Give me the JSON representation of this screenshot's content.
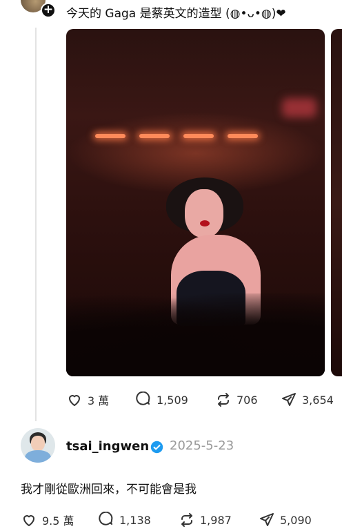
{
  "post1": {
    "text": "今天的 Gaga 是蔡英文的造型 (◍•ᴗ•◍)❤",
    "actions": {
      "likes": "3 萬",
      "comments": "1,509",
      "reposts": "706",
      "shares": "3,654"
    }
  },
  "post2": {
    "username": "tsai_ingwen",
    "date": "2025-5-23",
    "text": "我才剛從歐洲回來，不可能會是我",
    "actions": {
      "likes": "9.5 萬",
      "comments": "1,138",
      "reposts": "1,987",
      "shares": "5,090"
    }
  },
  "colors": {
    "verified": "#1d9bf0",
    "muted_text": "#999999",
    "icon": "#333333"
  },
  "icons": [
    "plus-icon",
    "heart-icon",
    "comment-icon",
    "repost-icon",
    "share-icon",
    "verified-badge-icon"
  ]
}
